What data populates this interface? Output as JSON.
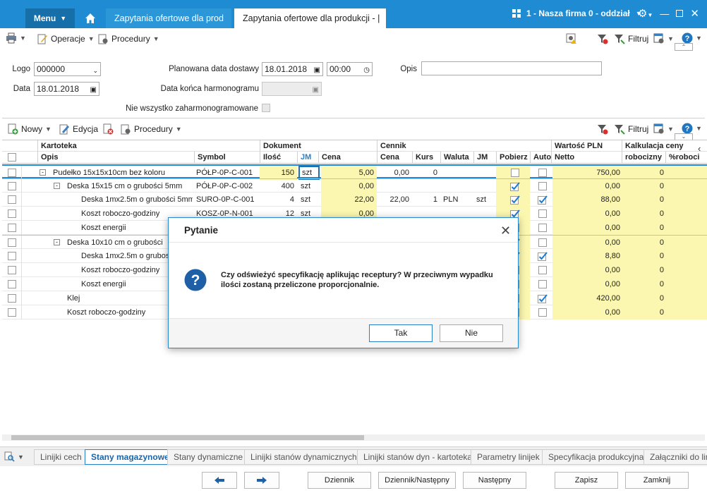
{
  "titlebar": {
    "menu_label": "Menu",
    "tabs": [
      {
        "label": "Zapytania ofertowe dla prod"
      },
      {
        "label": "Zapytania ofertowe dla produkcji - |"
      }
    ],
    "company": "1 - Nasza firma 0 - oddział"
  },
  "toolbar1": {
    "operacje": "Operacje",
    "procedury": "Procedury",
    "filtruj": "Filtruj"
  },
  "form": {
    "logo_label": "Logo",
    "logo_value": "000000",
    "data_label": "Data",
    "data_value": "18.01.2018",
    "planned_label": "Planowana data dostawy",
    "planned_date": "18.01.2018",
    "planned_time": "00:00",
    "harm_end_label": "Data końca harmonogramu",
    "harm_end_value": "",
    "opis_label": "Opis",
    "opis_value": "",
    "not_all_label": "Nie wszystko zaharmonogramowane"
  },
  "toolbar2": {
    "nowy": "Nowy",
    "edycja": "Edycja",
    "procedury": "Procedury",
    "filtruj": "Filtruj"
  },
  "grid": {
    "group_headers": {
      "kartoteka": "Kartoteka",
      "dokument": "Dokument",
      "cennik": "Cennik",
      "wartosc": "Wartość PLN",
      "kalkulacja": "Kalkulacja ceny"
    },
    "columns": {
      "opis": "Opis",
      "symbol": "Symbol",
      "ilosc": "Ilość",
      "jm": "JM",
      "cena": "Cena",
      "c_cena": "Cena",
      "kurs": "Kurs",
      "waluta": "Waluta",
      "c_jm": "JM",
      "pobierz": "Pobierz",
      "auto": "Auto",
      "netto": "Netto",
      "robociz": "robocizny",
      "proc": "%robociz"
    },
    "rows": [
      {
        "opis": "Pudełko 15x15x10cm bez koloru",
        "symbol": "PÓŁP-0P-C-001",
        "ilosc": "150",
        "jm": "szt",
        "cena": "5,00",
        "c_cena": "0,00",
        "kurs": "0",
        "waluta": "",
        "c_jm": "",
        "netto": "750,00",
        "robociz": "0"
      },
      {
        "opis": "Deska 15x15 cm o grubości 5mm",
        "symbol": "PÓŁP-0P-C-002",
        "ilosc": "400",
        "jm": "szt",
        "cena": "0,00",
        "c_cena": "",
        "kurs": "",
        "waluta": "",
        "c_jm": "",
        "netto": "0,00",
        "robociz": "0"
      },
      {
        "opis": "Deska 1mx2.5m o grubości 5mm",
        "symbol": "SURO-0P-C-001",
        "ilosc": "4",
        "jm": "szt",
        "cena": "22,00",
        "c_cena": "22,00",
        "kurs": "1",
        "waluta": "PLN",
        "c_jm": "szt",
        "netto": "88,00",
        "robociz": "0"
      },
      {
        "opis": "Koszt roboczo-godziny",
        "symbol": "KOSZ-0P-N-001",
        "ilosc": "12",
        "jm": "szt",
        "cena": "0,00",
        "c_cena": "",
        "kurs": "",
        "waluta": "",
        "c_jm": "",
        "netto": "0,00",
        "robociz": "0"
      },
      {
        "opis": "Koszt energii",
        "symbol": "",
        "ilosc": "",
        "jm": "",
        "cena": "",
        "c_cena": "",
        "kurs": "",
        "waluta": "",
        "c_jm": "",
        "netto": "0,00",
        "robociz": "0"
      },
      {
        "opis": "Deska 10x10 cm o grubości",
        "symbol": "",
        "ilosc": "",
        "jm": "",
        "cena": "",
        "c_cena": "",
        "kurs": "",
        "waluta": "",
        "c_jm": "",
        "netto": "0,00",
        "robociz": "0"
      },
      {
        "opis": "Deska 1mx2.5m o grubos",
        "symbol": "",
        "ilosc": "",
        "jm": "",
        "cena": "",
        "c_cena": "",
        "kurs": "",
        "waluta": "",
        "c_jm": "",
        "netto": "8,80",
        "robociz": "0"
      },
      {
        "opis": "Koszt roboczo-godziny",
        "symbol": "",
        "ilosc": "",
        "jm": "",
        "cena": "",
        "c_cena": "",
        "kurs": "",
        "waluta": "",
        "c_jm": "",
        "netto": "0,00",
        "robociz": "0"
      },
      {
        "opis": "Koszt energii",
        "symbol": "",
        "ilosc": "",
        "jm": "",
        "cena": "",
        "c_cena": "",
        "kurs": "",
        "waluta": "",
        "c_jm": "",
        "netto": "0,00",
        "robociz": "0"
      },
      {
        "opis": "Klej",
        "symbol": "",
        "ilosc": "",
        "jm": "",
        "cena": "",
        "c_cena": "",
        "kurs": "",
        "waluta": "",
        "c_jm": "",
        "netto": "420,00",
        "robociz": "0"
      },
      {
        "opis": "Koszt roboczo-godziny",
        "symbol": "",
        "ilosc": "",
        "jm": "",
        "cena": "",
        "c_cena": "",
        "kurs": "",
        "waluta": "",
        "c_jm": "",
        "netto": "0,00",
        "robociz": "0"
      }
    ]
  },
  "dialog": {
    "title": "Pytanie",
    "message": "Czy odświeżyć specyfikację aplikując receptury? W przeciwnym wypadku ilości zostaną przeliczone proporcjonalnie.",
    "yes": "Tak",
    "no": "Nie"
  },
  "bottom_tabs": [
    "Linijki cech",
    "Stany magazynowe",
    "Stany dynamiczne",
    "Linijki stanów dynamicznych",
    "Linijki stanów dyn - kartoteka",
    "Parametry linijek",
    "Specyfikacja produkcyjna",
    "Załączniki do lin"
  ],
  "bottom_buttons": {
    "dziennik": "Dziennik",
    "dziennik_nastepny": "Dziennik/Następny",
    "nastepny": "Następny",
    "zapisz": "Zapisz",
    "zamknij": "Zamknij"
  },
  "colors": {
    "accent": "#1e8bd3",
    "yellow_cell": "#fbf7b0",
    "selection": "#1e8bd3"
  }
}
